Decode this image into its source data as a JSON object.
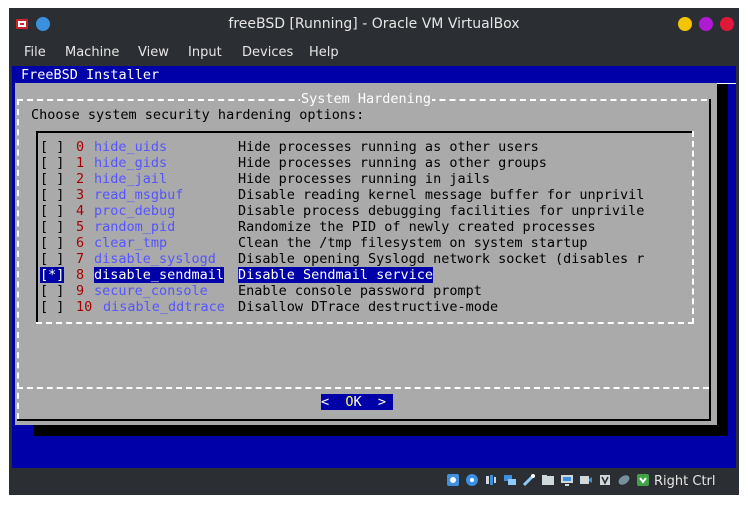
{
  "window": {
    "title": "freeBSD [Running] - Oracle VM VirtualBox",
    "accent_colors": {
      "minimize": "#f2c500",
      "maximize": "#b01ad0",
      "close": "#e0193a"
    }
  },
  "menubar": {
    "items": [
      "File",
      "Machine",
      "View",
      "Input",
      "Devices",
      "Help"
    ]
  },
  "installer": {
    "title": "FreeBSD Installer",
    "dialog": {
      "title": "System Hardening",
      "prompt": "Choose system security hardening options:",
      "options": [
        {
          "checkbox": "[ ]",
          "index": "0",
          "name": "hide_uids",
          "description": "Hide processes running as other users"
        },
        {
          "checkbox": "[ ]",
          "index": "1",
          "name": "hide_gids",
          "description": "Hide processes running as other groups"
        },
        {
          "checkbox": "[ ]",
          "index": "2",
          "name": "hide_jail",
          "description": "Hide processes running in jails"
        },
        {
          "checkbox": "[ ]",
          "index": "3",
          "name": "read_msgbuf",
          "description": "Disable reading kernel message buffer for unprivil"
        },
        {
          "checkbox": "[ ]",
          "index": "4",
          "name": "proc_debug",
          "description": "Disable process debugging facilities for unprivile"
        },
        {
          "checkbox": "[ ]",
          "index": "5",
          "name": "random_pid",
          "description": "Randomize the PID of newly created processes"
        },
        {
          "checkbox": "[ ]",
          "index": "6",
          "name": "clear_tmp",
          "description": "Clean the /tmp filesystem on system startup"
        },
        {
          "checkbox": "[ ]",
          "index": "7",
          "name": "disable_syslogd",
          "description": "Disable opening Syslogd network socket (disables r"
        },
        {
          "checkbox": "[*]",
          "index": "8",
          "name": "disable_sendmail",
          "description": "Disable Sendmail service",
          "selected": true
        },
        {
          "checkbox": "[ ]",
          "index": "9",
          "name": "secure_console",
          "description": "Enable console password prompt"
        },
        {
          "checkbox": "[ ]",
          "index": "10",
          "name": "disable_ddtrace",
          "description": "Disallow DTrace destructive-mode"
        }
      ],
      "ok_button": {
        "left": "<  ",
        "key": "O",
        "rest": "K  >"
      }
    }
  },
  "statusbar": {
    "icons": [
      "hard-disk-icon",
      "optical-disk-icon",
      "audio-icon",
      "network-icon",
      "usb-icon",
      "shared-folders-icon",
      "display-icon",
      "video-capture-icon",
      "cpu-icon",
      "mouse-integration-icon",
      "keyboard-icon"
    ],
    "host_key": "Right Ctrl"
  }
}
